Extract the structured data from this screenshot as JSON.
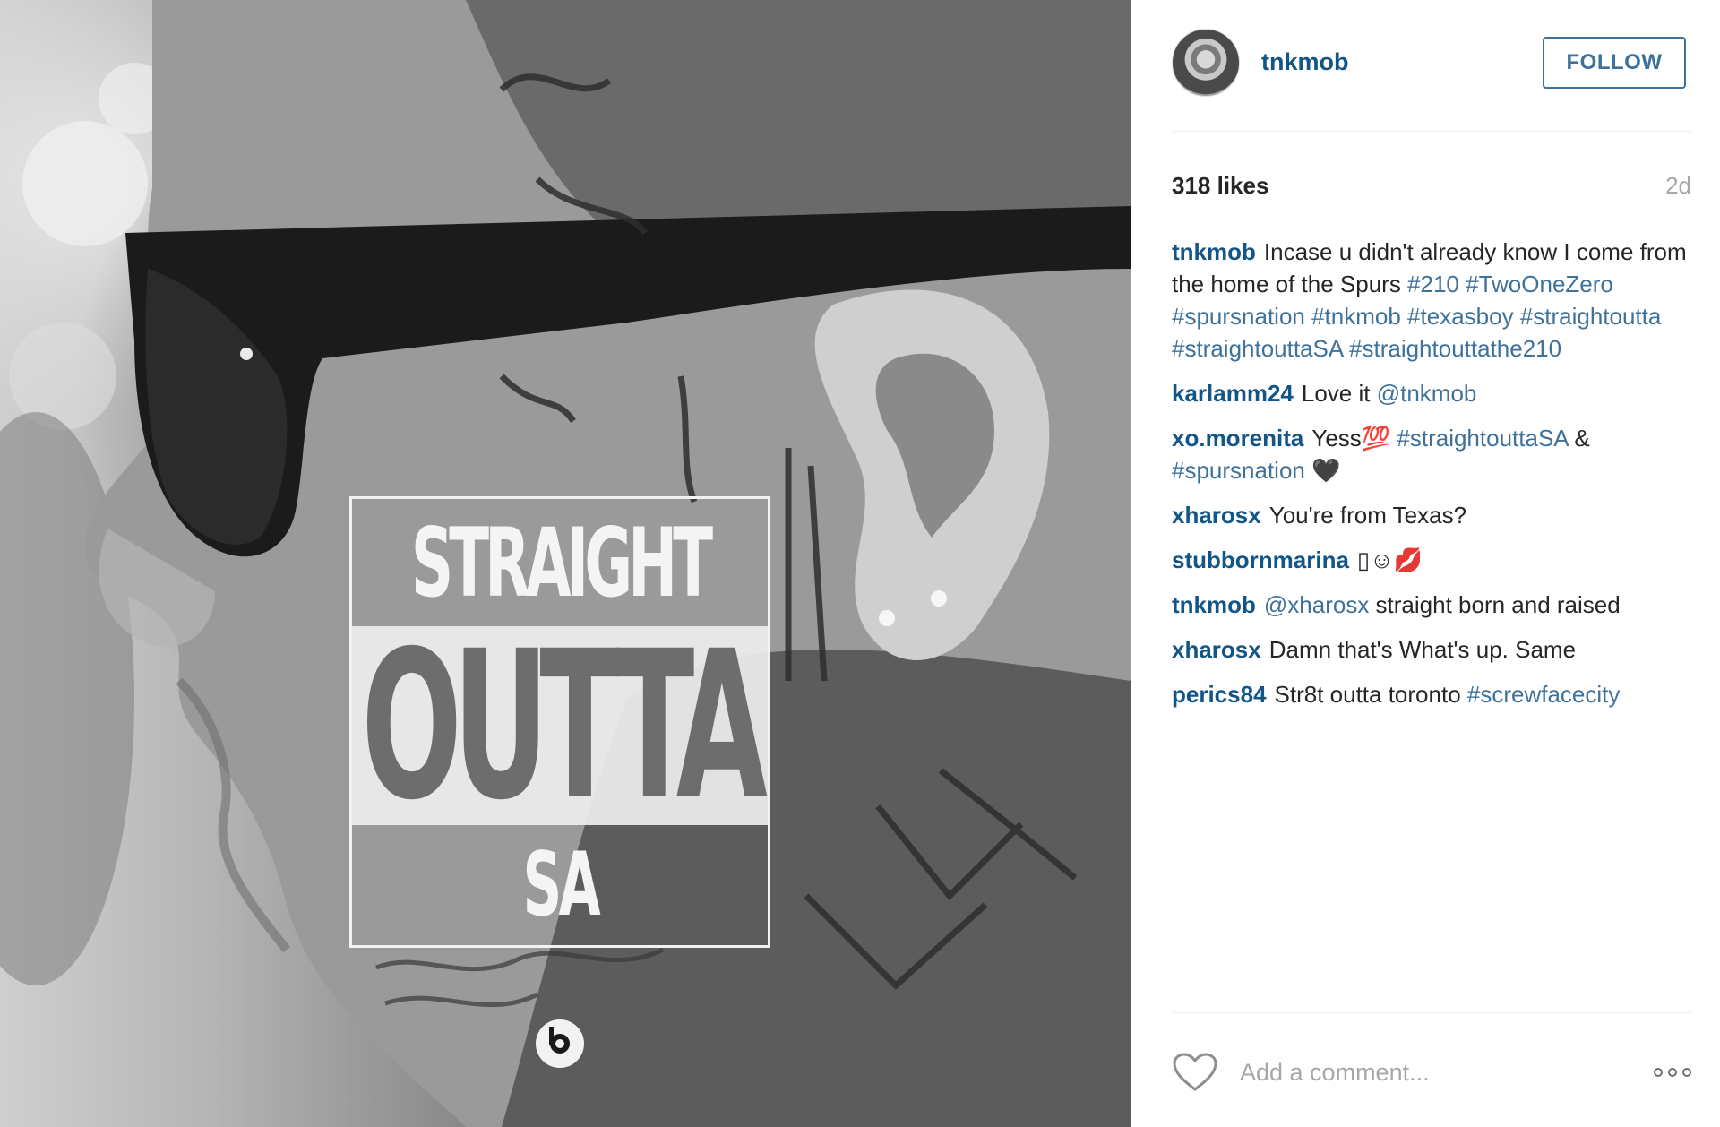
{
  "post": {
    "poster_text": {
      "line1": "STRAIGHT",
      "line2": "OUTTA",
      "line3": "SA"
    },
    "beats_icon": "beats-logo-icon"
  },
  "header": {
    "username": "tnkmob",
    "follow_label": "FOLLOW",
    "avatar_icon": "profile-avatar"
  },
  "meta": {
    "likes": "318 likes",
    "time": "2d"
  },
  "caption": {
    "user": "tnkmob",
    "text": "Incase u didn't already know I come from the home of the Spurs ",
    "tags": "#210 #TwoOneZero #spursnation #tnkmob #texasboy #straightoutta #straightouttaSA #straightouttathe210"
  },
  "comments": [
    {
      "user": "karlamm24",
      "text": "Love it ",
      "tag": "@tnkmob"
    },
    {
      "user": "xo.morenita",
      "text": "Yess💯 ",
      "tag": "#straightouttaSA",
      "after": " & ",
      "tag2": "#spursnation",
      "after2": " 🖤"
    },
    {
      "user": "xharosx",
      "text": "You're from Texas?"
    },
    {
      "user": "stubbornmarina",
      "text": "▯☺💋"
    },
    {
      "user": "tnkmob",
      "tag": "@xharosx",
      "text": " straight born and raised"
    },
    {
      "user": "xharosx",
      "text": "Damn that's What's up. Same"
    },
    {
      "user": "perics84",
      "text": "Str8t outta toronto ",
      "tag": "#screwfacecity"
    }
  ],
  "footer": {
    "comment_placeholder": "Add a comment...",
    "like_icon": "heart-icon",
    "more_icon": "more-options-icon"
  },
  "colors": {
    "link_blue": "#125688",
    "tag_blue": "#3f729b",
    "muted": "#a5a7aa"
  }
}
